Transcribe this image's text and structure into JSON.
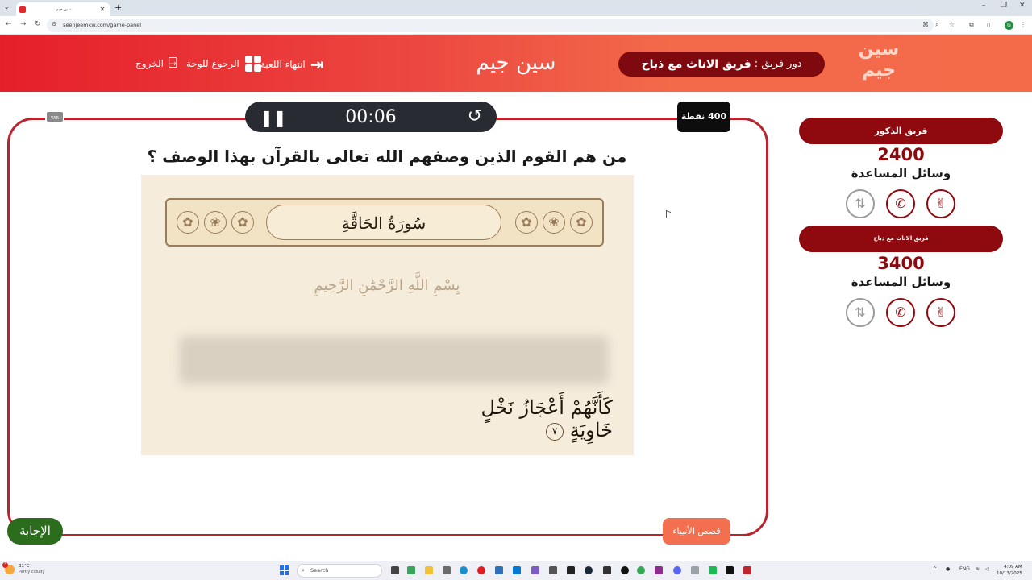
{
  "browser": {
    "tab_title": "سين جيم",
    "url": "seenjeemkw.com/game-panel",
    "new_tab": "+",
    "close": "✕",
    "profile_initial": "G"
  },
  "header": {
    "logo_line1": "سين",
    "logo_line2": "جيم",
    "turn_label": "دور فريق :",
    "turn_team": "فريق الاناث مع ذباح",
    "brand": "سين جيم",
    "end_game": "انتهاء اللعبة",
    "back_to_board": "الرجوع للوحة",
    "exit": "الخروج"
  },
  "game": {
    "timer": "00:06",
    "points": "400 نقطة",
    "var_label": "VAR",
    "question": "من هم القوم الذين وصفهم الله تعالى بالقرآن بهذا الوصف ؟",
    "image": {
      "surah_title": "سُورَةُ الحَاقَّةِ",
      "basmala": "بِسْمِ اللَّهِ الرَّحْمَٰنِ الرَّحِيمِ",
      "verse": "كَأَنَّهُمْ أَعْجَازُ نَخْلٍ خَاوِيَةٍ",
      "ayah_number": "٧"
    },
    "answer_button": "الإجابة",
    "category_button": "قصص الأنبياء"
  },
  "teams": [
    {
      "name": "فريق الذكور",
      "score": "2400",
      "aids_label": "وسائل المساعدة"
    },
    {
      "name": "فريق الاناث مع ذباح",
      "score": "3400",
      "aids_label": "وسائل المساعدة"
    }
  ],
  "taskbar": {
    "temp": "31°C",
    "weather": "Partly cloudy",
    "weather_badge": "3",
    "search_placeholder": "Search",
    "lang": "ENG",
    "time": "4:09 AM",
    "date": "10/13/2025"
  },
  "colors": {
    "brand_red": "#e51f2a",
    "dark_red": "#8f0a0e",
    "answer_green": "#2c6d1d",
    "category_orange": "#f26f4f"
  }
}
